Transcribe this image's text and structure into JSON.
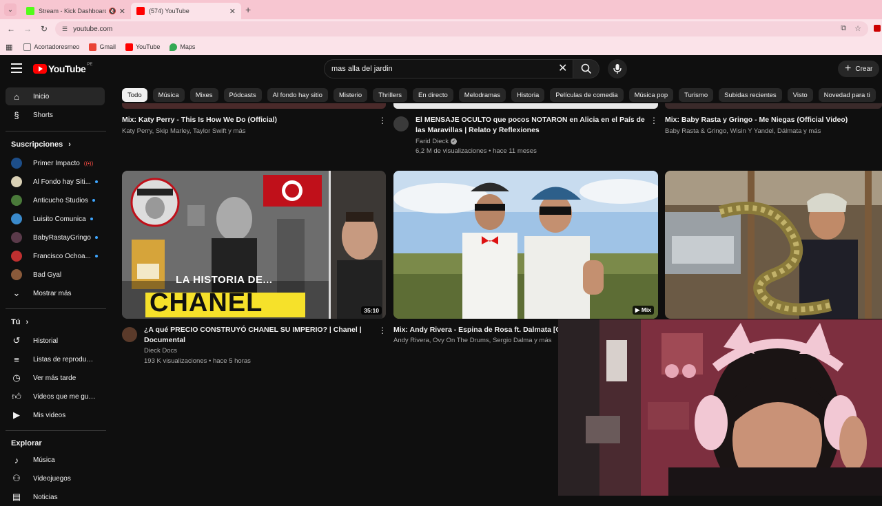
{
  "browser": {
    "tabs": [
      {
        "title": "Stream - Kick Dashboard",
        "favicon_color": "#53fc18",
        "active": false
      },
      {
        "title": "(574) YouTube",
        "favicon_color": "#ff0000",
        "active": true
      }
    ],
    "url": "youtube.com",
    "bookmarks": [
      {
        "label": "Acortadoresmeo",
        "icon_color": "#c9a15b"
      },
      {
        "label": "Gmail",
        "icon_color": "#ea4335"
      },
      {
        "label": "YouTube",
        "icon_color": "#ff0000"
      },
      {
        "label": "Maps",
        "icon_color": "#34a853"
      }
    ]
  },
  "header": {
    "logo_text": "YouTube",
    "country": "PE",
    "search_value": "mas alla del jardin",
    "create_label": "Crear"
  },
  "sidebar": {
    "main": [
      {
        "label": "Inicio",
        "icon": "home-icon"
      },
      {
        "label": "Shorts",
        "icon": "shorts-icon"
      }
    ],
    "subscriptions_heading": "Suscripciones",
    "subscriptions": [
      {
        "label": "Primer Impacto",
        "avatar_color": "#1d4e89",
        "live": true
      },
      {
        "label": "Al Fondo hay Siti...",
        "avatar_color": "#d9d0b5",
        "dot": true
      },
      {
        "label": "Anticucho Studios",
        "avatar_color": "#4a7a3a",
        "dot": true
      },
      {
        "label": "Luisito Comunica",
        "avatar_color": "#3a8acb",
        "dot": true
      },
      {
        "label": "BabyRastayGringo",
        "avatar_color": "#5a3a4a",
        "dot": true
      },
      {
        "label": "Francisco Ochoa...",
        "avatar_color": "#c03030",
        "dot": true
      },
      {
        "label": "Bad Gyal",
        "avatar_color": "#8a5a3a",
        "dot": false
      }
    ],
    "show_more": "Mostrar más",
    "you_heading": "Tú",
    "you_items": [
      {
        "label": "Historial",
        "icon": "history-icon"
      },
      {
        "label": "Listas de reproducc...",
        "icon": "playlist-icon"
      },
      {
        "label": "Ver más tarde",
        "icon": "watch-later-icon"
      },
      {
        "label": "Videos que me gus...",
        "icon": "like-icon"
      },
      {
        "label": "Mis videos",
        "icon": "my-videos-icon"
      }
    ],
    "explore_heading": "Explorar",
    "explore_items": [
      {
        "label": "Música",
        "icon": "music-icon"
      },
      {
        "label": "Videojuegos",
        "icon": "gaming-icon"
      },
      {
        "label": "Noticias",
        "icon": "news-icon"
      }
    ]
  },
  "chips": [
    "Todo",
    "Música",
    "Mixes",
    "Pódcasts",
    "Al fondo hay sitio",
    "Misterio",
    "Thrillers",
    "En directo",
    "Melodramas",
    "Historia",
    "Películas de comedia",
    "Música pop",
    "Turismo",
    "Subidas recientes",
    "Visto",
    "Novedad para ti"
  ],
  "videos_row1": [
    {
      "title": "Mix: Katy Perry - This Is How We Do (Official)",
      "meta": "Katy Perry, Skip Marley, Taylor Swift y más"
    },
    {
      "title": "El MENSAJE OCULTO que pocos NOTARON en Alicia en el País de las Maravillas | Relato y Reflexiones",
      "channel": "Farid Dieck",
      "views": "6,2 M de visualizaciones • hace 11 meses"
    },
    {
      "title": "Mix: Baby Rasta y Gringo - Me Niegas (Official Video)",
      "meta": "Baby Rasta & Gringo, Wisin Y Yandel, Dálmata y más"
    }
  ],
  "videos_row2": [
    {
      "title": "¿A qué PRECIO CONSTRUYÓ CHANEL SU IMPERIO? | Chanel | Documental",
      "channel": "Dieck Docs",
      "views": "193 K visualizaciones • hace 5 horas",
      "duration": "35:10",
      "thumb_text_1": "LA HISTORIA DE...",
      "thumb_text_2": "CHANEL"
    },
    {
      "title": "Mix: Andy Rivera - Espina de Rosa ft. Dalmata [Of",
      "meta": "Andy Rivera, Ovy On The Drums, Sergio Dalma y más",
      "badge": "Mix"
    },
    {
      "title": "",
      "meta": ""
    }
  ]
}
